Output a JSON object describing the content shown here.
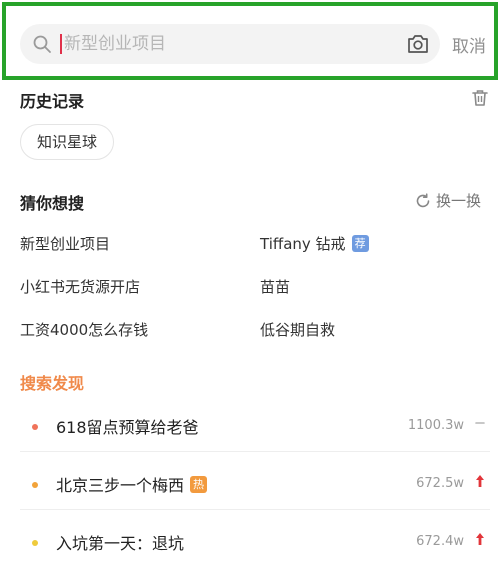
{
  "search": {
    "placeholder": "新型创业项目",
    "cancel_label": "取消"
  },
  "history": {
    "title": "历史记录",
    "items": [
      "知识星球"
    ]
  },
  "guess": {
    "title": "猜你想搜",
    "refresh_label": "换一换",
    "items": [
      {
        "label": "新型创业项目"
      },
      {
        "label": "Tiffany 钻戒",
        "tag": "荐"
      },
      {
        "label": "小红书无货源开店"
      },
      {
        "label": "苗苗"
      },
      {
        "label": "工资4000怎么存钱"
      },
      {
        "label": "低谷期自救"
      }
    ]
  },
  "discover": {
    "title": "搜索发现",
    "items": [
      {
        "label": "618留点预算给老爸",
        "count": "1100.3w",
        "trend": "flat",
        "dot_color": "#f0735a"
      },
      {
        "label": "北京三步一个梅西",
        "tag": "热",
        "count": "672.5w",
        "trend": "up",
        "dot_color": "#f2a33a"
      },
      {
        "label": "入坑第一天：退坑",
        "count": "672.4w",
        "trend": "up",
        "dot_color": "#efcb3c"
      }
    ]
  },
  "colors": {
    "accent_green": "#27a32a",
    "discover_orange": "#f08a4b",
    "trend_up": "#e2353a",
    "caret": "#e0304a"
  }
}
